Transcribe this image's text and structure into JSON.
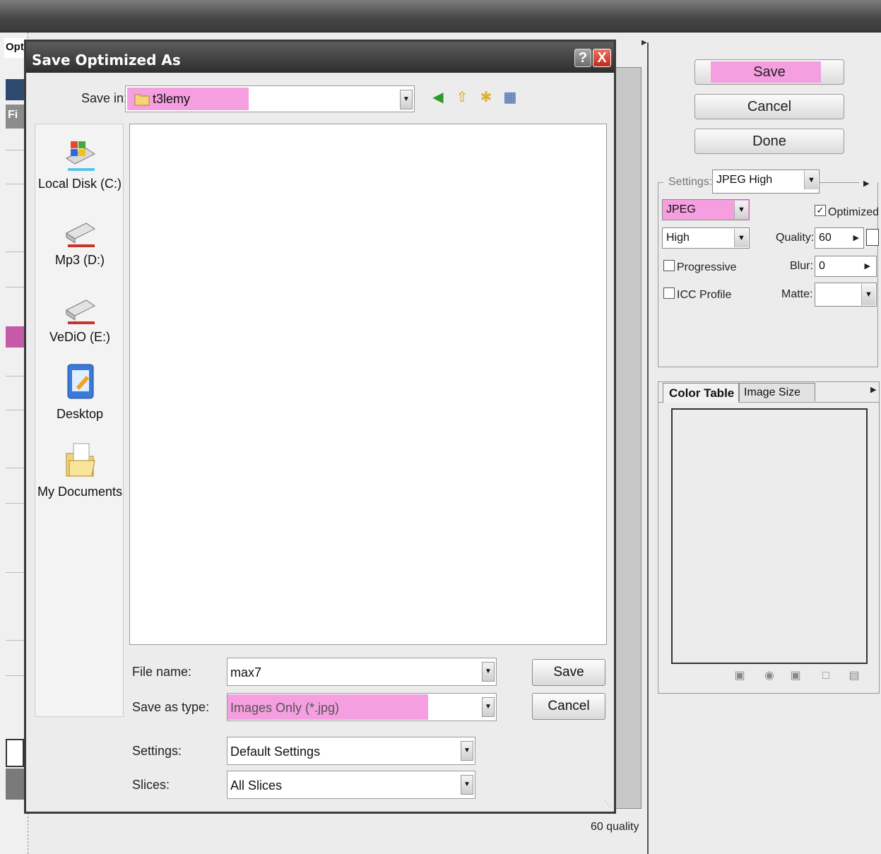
{
  "background": {
    "left_tab_label": "Opti",
    "left_grey_label": "Fi",
    "status_text": "60 quality"
  },
  "right_panel": {
    "buttons": {
      "save": "Save",
      "cancel": "Cancel",
      "done": "Done"
    },
    "settings_label": "Settings:",
    "settings_value": "JPEG High",
    "format_value": "JPEG",
    "optimized_label": "Optimized",
    "optimized_checked": true,
    "quality_level": "High",
    "quality_label": "Quality:",
    "quality_value": "60",
    "progressive_label": "Progressive",
    "blur_label": "Blur:",
    "blur_value": "0",
    "icc_label": "ICC Profile",
    "matte_label": "Matte:",
    "tabs": [
      "Color Table",
      "Image Size"
    ]
  },
  "dialog": {
    "title": "Save Optimized As",
    "help_glyph": "?",
    "close_glyph": "X",
    "save_in_label": "Save in:",
    "save_in_value": "t3lemy",
    "places": [
      {
        "label": "Local Disk (C:)",
        "icon": "local-disk-icon"
      },
      {
        "label": "Mp3 (D:)",
        "icon": "drive-icon"
      },
      {
        "label": "VeDiO (E:)",
        "icon": "drive-icon"
      },
      {
        "label": "Desktop",
        "icon": "desktop-icon"
      },
      {
        "label": "My Documents",
        "icon": "my-documents-icon"
      }
    ],
    "file_name_label": "File name:",
    "file_name_value": "max7",
    "save_as_type_label": "Save as type:",
    "save_as_type_value": "Images Only (*.jpg)",
    "settings_label": "Settings:",
    "settings_value": "Default Settings",
    "slices_label": "Slices:",
    "slices_value": "All Slices",
    "save_button": "Save",
    "cancel_button": "Cancel"
  },
  "colors": {
    "highlight_pink": "#f59ee0",
    "title_bar": "#2e2e2e",
    "close_red": "#c0281a"
  }
}
